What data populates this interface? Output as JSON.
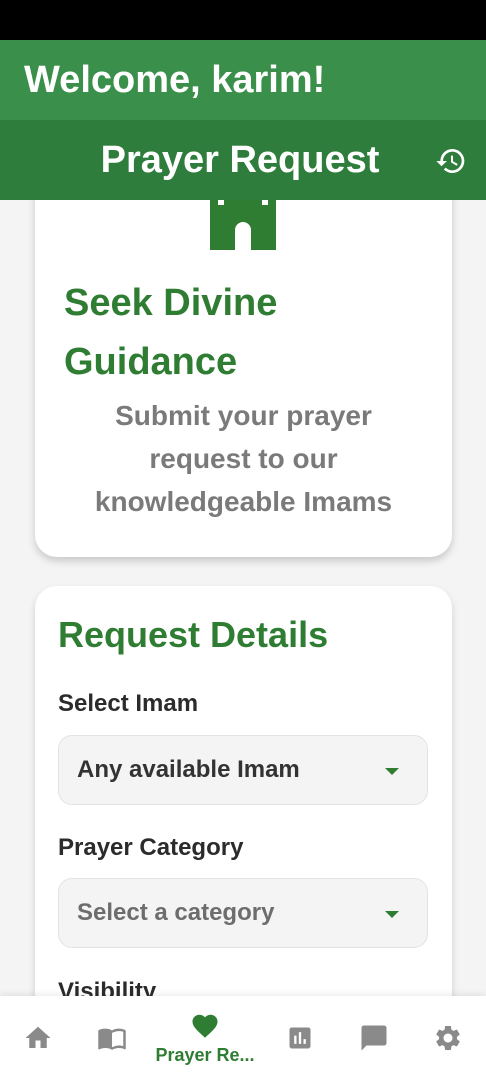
{
  "welcome_text": "Welcome, karim!",
  "appbar": {
    "title": "Prayer Request",
    "history_icon": "history-icon"
  },
  "hero": {
    "title": "Seek Divine Guidance",
    "subtitle": "Submit your prayer request to our knowledgeable Imams"
  },
  "form": {
    "title": "Request Details",
    "imam_label": "Select Imam",
    "imam_value": "Any available Imam",
    "category_label": "Prayer Category",
    "category_placeholder": "Select a category",
    "visibility_label": "Visibility"
  },
  "bottom_nav": {
    "items": [
      {
        "icon": "home-icon"
      },
      {
        "icon": "book-icon"
      },
      {
        "icon": "heart-icon",
        "label": "Prayer Re...",
        "active": true
      },
      {
        "icon": "chart-icon"
      },
      {
        "icon": "chat-icon"
      },
      {
        "icon": "gear-icon"
      }
    ]
  },
  "colors": {
    "primary": "#2e7d3c",
    "welcome_bar": "#3a8f4a",
    "accent_text": "#2e7d32",
    "icon_gray": "#8a8a8a"
  }
}
